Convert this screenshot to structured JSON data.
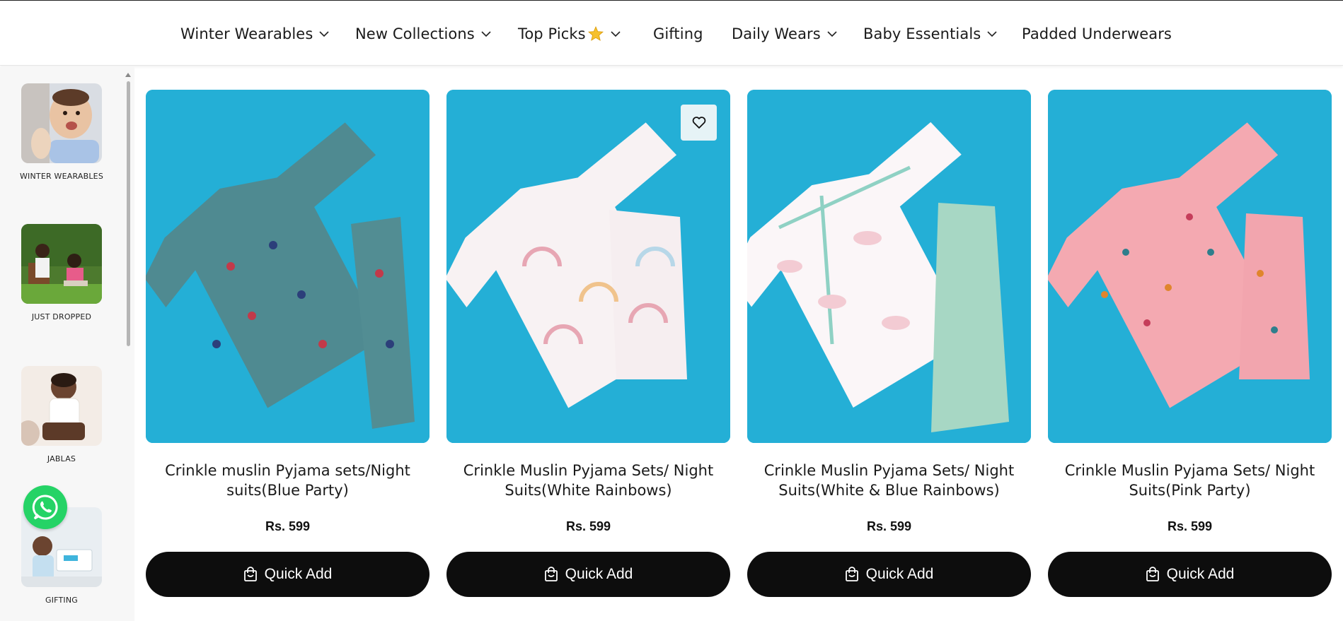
{
  "nav": {
    "items": [
      {
        "label": "Winter Wearables",
        "chevron": true
      },
      {
        "label": "New Collections",
        "chevron": true
      },
      {
        "label": "Top Picks",
        "chevron": true,
        "star": true
      },
      {
        "label": "Gifting",
        "chevron": false
      },
      {
        "label": "Daily Wears",
        "chevron": true
      },
      {
        "label": "Baby Essentials",
        "chevron": true
      },
      {
        "label": "Padded Underwears",
        "chevron": false
      }
    ]
  },
  "sidebar": {
    "categories": [
      {
        "label": "WINTER WEARABLES",
        "icon": "baby-photo"
      },
      {
        "label": "JUST DROPPED",
        "icon": "kids-garden-photo"
      },
      {
        "label": "JABLAS",
        "icon": "kid-jabla-photo"
      },
      {
        "label": "GIFTING",
        "icon": "baby-gift-photo"
      }
    ]
  },
  "products": [
    {
      "title": "Crinkle muslin Pyjama sets/Night suits(Blue Party)",
      "price": "Rs. 599",
      "button": "Quick Add"
    },
    {
      "title": "Crinkle Muslin Pyjama Sets/ Night Suits(White Rainbows)",
      "price": "Rs. 599",
      "button": "Quick Add"
    },
    {
      "title": "Crinkle Muslin Pyjama Sets/ Night Suits(White & Blue Rainbows)",
      "price": "Rs. 599",
      "button": "Quick Add"
    },
    {
      "title": "Crinkle Muslin Pyjama Sets/ Night Suits(Pink Party)",
      "price": "Rs. 599",
      "button": "Quick Add"
    }
  ],
  "colors": {
    "accent_dark": "#0d0d0d",
    "product_bg": "#27b3d9",
    "whatsapp": "#25d366"
  }
}
